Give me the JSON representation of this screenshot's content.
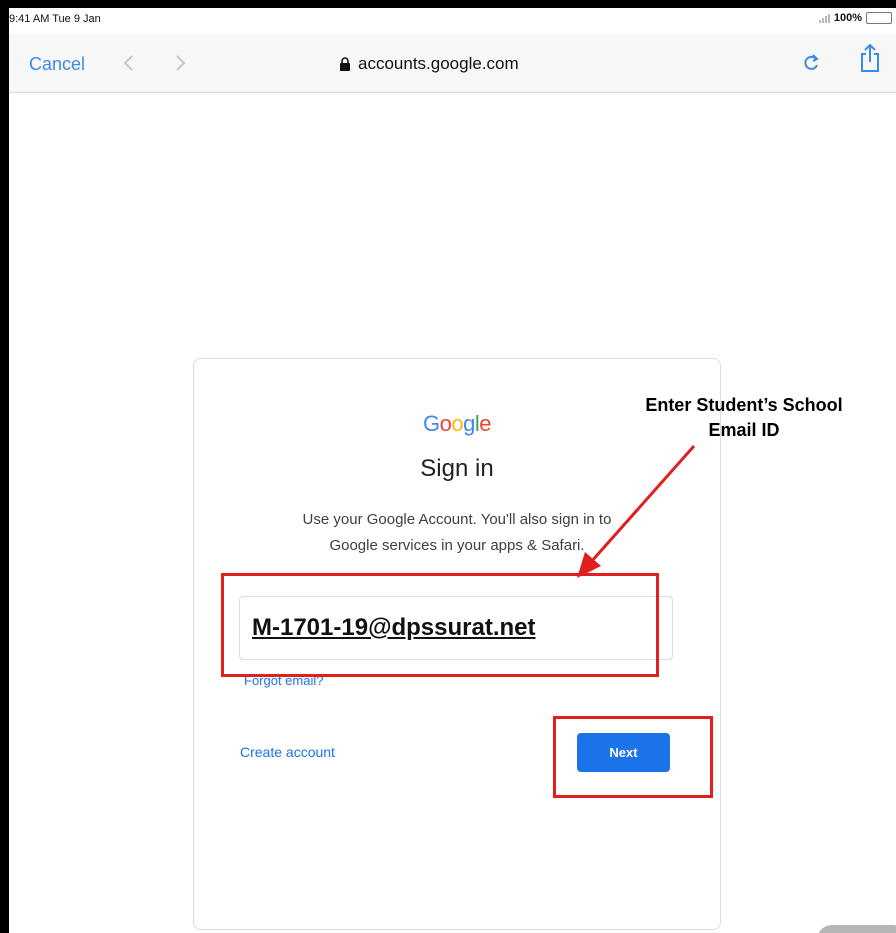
{
  "status_bar": {
    "time": "9:41 AM  Tue 9 Jan",
    "battery": "100%",
    "battery_level": 1.0
  },
  "navbar": {
    "cancel_label": "Cancel",
    "back_icon": "chevron-left-icon",
    "forward_icon": "chevron-right-icon",
    "url": "accounts.google.com",
    "reload_icon": "reload-icon",
    "share_icon": "share-icon",
    "accent_color": "#3b8ae8"
  },
  "signin": {
    "logo_letters": [
      {
        "char": "G",
        "color": "#4285f4"
      },
      {
        "char": "o",
        "color": "#ea4335"
      },
      {
        "char": "o",
        "color": "#fbbc05"
      },
      {
        "char": "g",
        "color": "#4285f4"
      },
      {
        "char": "l",
        "color": "#34a853"
      },
      {
        "char": "e",
        "color": "#ea4335"
      }
    ],
    "title": "Sign in",
    "subtitle_line1": "Use your Google Account. You'll also sign in to",
    "subtitle_line2": "Google services in your apps & Safari.",
    "email_value": "M-1701-19@dpssurat.net",
    "forgot_email": "Forgot email?",
    "create_account": "Create account",
    "next_label": "Next",
    "primary_color": "#1a73e8"
  },
  "annotation": {
    "callout_line1": "Enter Student’s School",
    "callout_line2": "Email ID",
    "color": "#e01f1f"
  }
}
